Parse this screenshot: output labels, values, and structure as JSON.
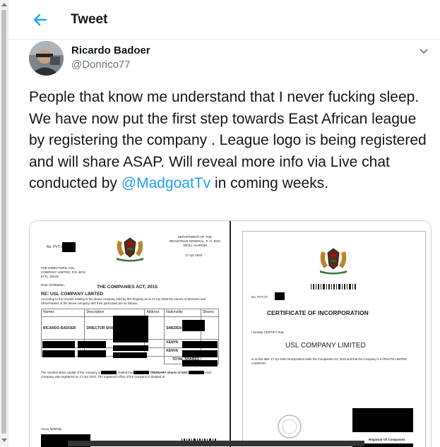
{
  "header": {
    "title": "Tweet"
  },
  "author": {
    "name": "Ricardo Badoer",
    "handle": "@Donrico77"
  },
  "tweet": {
    "text_before": "People that know me understand that I never fucking sleep. We have now put the first step towards East African league by registering the company . League logo is being registered and will share ASAP. Will reveal more info via Live  chat conducted by ",
    "mention": "@MadgoatTv",
    "text_after": " in coming weeks."
  },
  "doc1": {
    "no": "No. PVT-27",
    "dept": "DEPARTMENT OF THE REGISTRAR GENERAL, P. O. BOX 30031, NAIROBI",
    "date": "17 Apr 2020",
    "addressee": "THE DIRECTORS, USL COMPANY LIMITED, P.O. BOX 5771, 00100",
    "greeting": "Dear Sir/Madam,",
    "act": "THE COMPANIES ACT, 2015",
    "re": "RE: USL COMPANY LIMITED",
    "intro": "According to the records relating to the above company held by this Registry as at 17 Apr 2020 the names of Directors and Shareholders of the above company with their particulars are as follows.",
    "columns": [
      "Names",
      "Description",
      "Address",
      "Nationality",
      "Shares"
    ],
    "row1": {
      "name": "RICARDO BADOER",
      "description": "DIRECTOR SHAREHOLDER",
      "nationality": "SWEDEN"
    },
    "row2_nationality": "KENYA",
    "row3_nationality": "KENYA",
    "total_label": "TOTAL SHARES",
    "capital_a": "The nominal share capital of the company is",
    "capital_b": "divided into",
    "capital_c": "ORDINARY shares of KES",
    "capital_d": "each . Company was registered on 17 Apr 2020. The registered office of the company is situated at",
    "closing": "Yours faithfully,"
  },
  "doc2": {
    "no": "No. PVT-27",
    "title": "CERTIFICATE OF INCORPORATION",
    "certify": "I hereby CERTIFY that,",
    "company": "USL COMPANY LIMITED",
    "body": "is on this date 17 Apr 2020 incorporated under the Companies Act, 2015 and that the Company is a PRIVATE LIMITED COMPANY.",
    "signature_label": "Registrar Of Companies"
  }
}
